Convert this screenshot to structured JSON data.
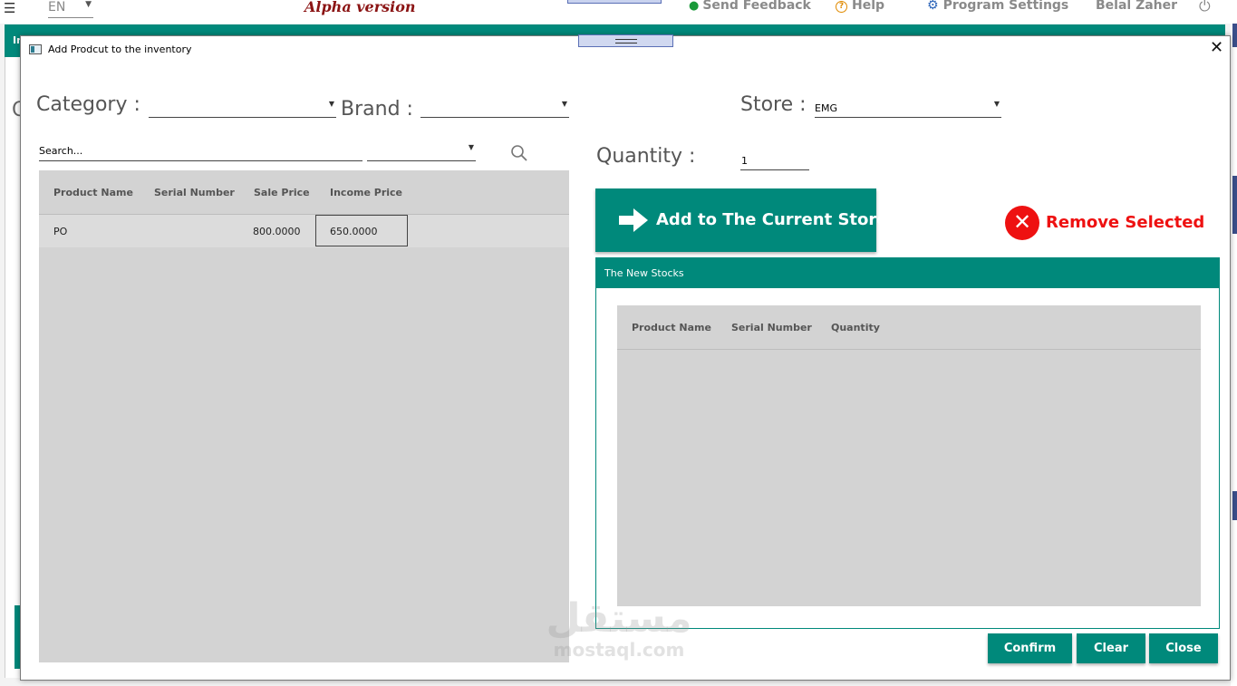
{
  "topbar": {
    "language": "EN",
    "version_label": "Alpha version",
    "feedback_label": "Send Feedback",
    "help_label": "Help",
    "settings_label": "Program Settings",
    "user_name": "Belal Zaher",
    "background_tab_prefix": "In",
    "background_c": "C"
  },
  "dialog": {
    "title": "Add Prodcut to the inventory",
    "category_label": "Category :",
    "category_value": "",
    "brand_label": "Brand :",
    "brand_value": "",
    "store_label": "Store :",
    "store_value": "EMG",
    "search_placeholder": "Search...",
    "filter_value": "",
    "quantity_label": "Quantity :",
    "quantity_value": "1",
    "add_button_label": "Add to The Current Store",
    "remove_label": "Remove Selected",
    "new_stocks_title": "The New Stocks",
    "buttons": {
      "confirm": "Confirm",
      "clear": "Clear",
      "close": "Close"
    }
  },
  "products_table": {
    "columns": [
      "Product Name",
      "Serial Number",
      "Sale Price",
      "Income Price"
    ],
    "rows": [
      {
        "product_name": "PO",
        "serial_number": "",
        "sale_price": "800.0000",
        "income_price": "650.0000"
      }
    ]
  },
  "stocks_table": {
    "columns": [
      "Product Name",
      "Serial Number",
      "Quantity"
    ],
    "rows": []
  },
  "watermark": {
    "arabic": "مستقل",
    "latin": "mostaql.com"
  },
  "colors": {
    "accent": "#00897b",
    "danger": "#ee1111",
    "version": "#8b1414",
    "grid_bg": "#d3d3d3"
  },
  "icons": [
    "menu-icon",
    "bulb-icon",
    "help-icon",
    "gear-icon",
    "power-icon",
    "window-icon",
    "close-icon",
    "search-icon",
    "arrow-right-icon",
    "remove-x-icon",
    "chevron-down-icon"
  ]
}
